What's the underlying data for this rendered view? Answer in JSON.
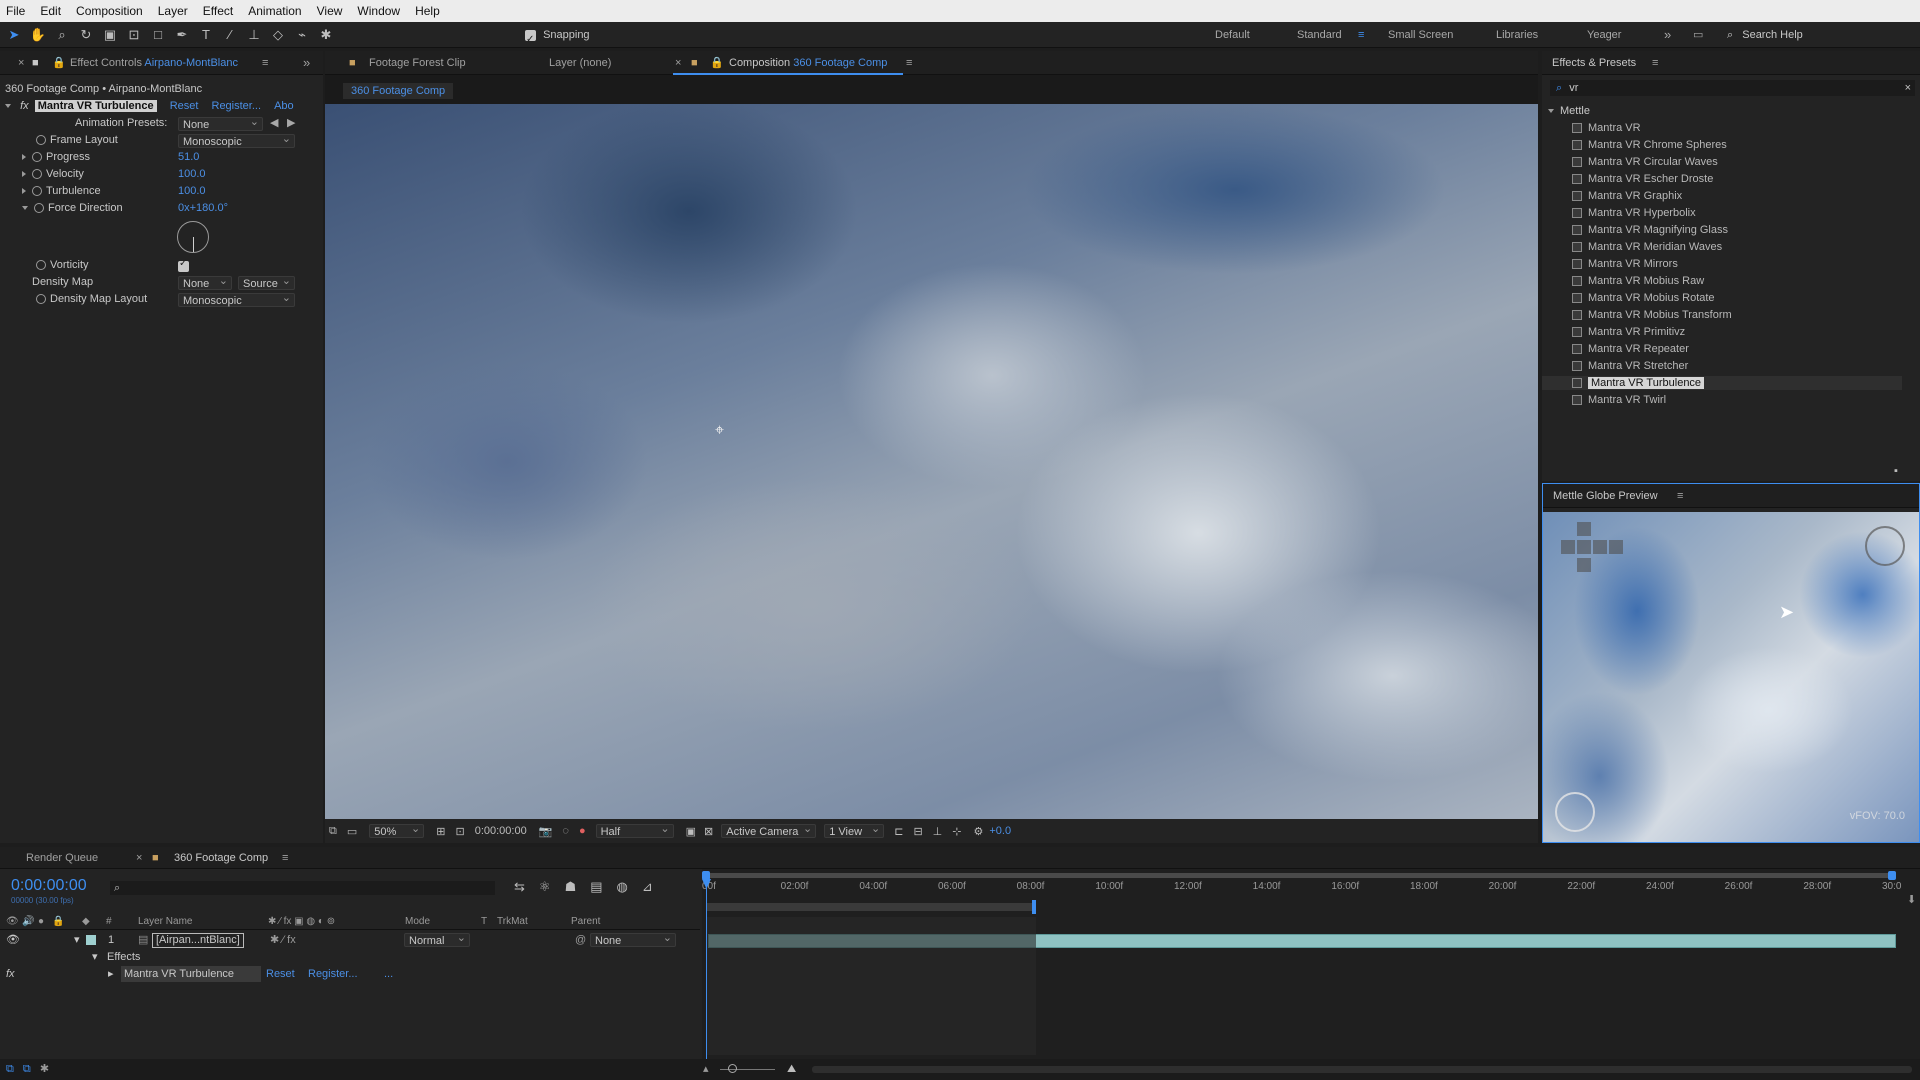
{
  "menu": [
    "File",
    "Edit",
    "Composition",
    "Layer",
    "Effect",
    "Animation",
    "View",
    "Window",
    "Help"
  ],
  "toolbar": {
    "snapping_label": "Snapping",
    "workspaces": [
      "Default",
      "Standard",
      "Small Screen",
      "Libraries",
      "Yeager"
    ],
    "active_workspace": "Standard",
    "search_placeholder": "Search Help"
  },
  "effect_controls": {
    "tab_prefix": "Effect Controls",
    "tab_layer": "Airpano-MontBlanc",
    "breadcrumb": "360 Footage Comp • Airpano-MontBlanc",
    "effect_name": "Mantra VR Turbulence",
    "reset": "Reset",
    "register": "Register...",
    "about": "Abo",
    "animation_presets_label": "Animation Presets:",
    "animation_presets_value": "None",
    "frame_layout_label": "Frame Layout",
    "frame_layout_value": "Monoscopic",
    "progress_label": "Progress",
    "progress_value": "51.0",
    "velocity_label": "Velocity",
    "velocity_value": "100.0",
    "turbulence_label": "Turbulence",
    "turbulence_value": "100.0",
    "force_direction_label": "Force Direction",
    "force_direction_value": "0x+180.0°",
    "vorticity_label": "Vorticity",
    "density_map_label": "Density Map",
    "density_map_value": "None",
    "density_map_source": "Source",
    "density_map_layout_label": "Density Map Layout",
    "density_map_layout_value": "Monoscopic"
  },
  "viewer": {
    "tab_footage": "Footage Forest Clip",
    "tab_layer": "Layer (none)",
    "tab_comp_prefix": "Composition",
    "tab_comp_name": "360 Footage Comp",
    "comp_chip": "360 Footage Comp",
    "zoom": "50%",
    "timecode": "0:00:00:00",
    "resolution": "Half",
    "camera": "Active Camera",
    "views": "1 View",
    "exposure": "+0.0"
  },
  "effects_presets": {
    "title": "Effects & Presets",
    "search_value": "vr",
    "group": "Mettle",
    "items": [
      "Mantra VR",
      "Mantra VR Chrome Spheres",
      "Mantra VR Circular Waves",
      "Mantra VR Escher Droste",
      "Mantra VR Graphix",
      "Mantra VR Hyperbolix",
      "Mantra VR Magnifying Glass",
      "Mantra VR Meridian Waves",
      "Mantra VR Mirrors",
      "Mantra VR Mobius Raw",
      "Mantra VR Mobius Rotate",
      "Mantra VR Mobius Transform",
      "Mantra VR Primitivz",
      "Mantra VR Repeater",
      "Mantra VR Stretcher",
      "Mantra VR Turbulence",
      "Mantra VR Twirl"
    ],
    "selected_index": 15
  },
  "globe_preview": {
    "title": "Mettle Globe Preview",
    "fov": "vFOV: 70.0"
  },
  "timeline": {
    "tab_render": "Render Queue",
    "tab_comp": "360 Footage Comp",
    "timecode": "0:00:00:00",
    "frame_info": "00000 (30.00 fps)",
    "col_layer_name": "Layer Name",
    "col_mode": "Mode",
    "col_t": "T",
    "col_trkmat": "TrkMat",
    "col_parent": "Parent",
    "layer_num": "1",
    "layer_name": "[Airpan...ntBlanc]",
    "layer_mode": "Normal",
    "layer_parent": "None",
    "effects_label": "Effects",
    "effect_row": "Mantra VR Turbulence",
    "effect_reset": "Reset",
    "effect_register": "Register...",
    "effect_more": "...",
    "ruler": [
      "00f",
      "02:00f",
      "04:00f",
      "06:00f",
      "08:00f",
      "10:00f",
      "12:00f",
      "14:00f",
      "16:00f",
      "18:00f",
      "20:00f",
      "22:00f",
      "24:00f",
      "26:00f",
      "28:00f",
      "30:0"
    ]
  }
}
